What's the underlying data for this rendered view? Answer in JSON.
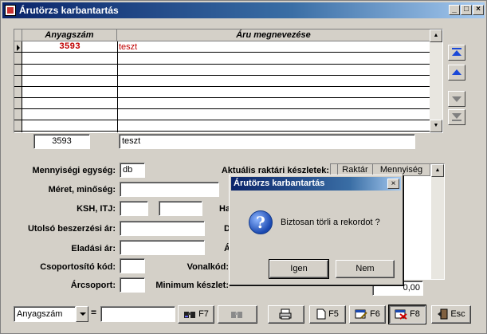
{
  "window": {
    "title": "Árutörzs karbantartás",
    "controls": {
      "min": "_",
      "max": "□",
      "close": "×"
    }
  },
  "grid": {
    "columns": [
      "Anyagszám",
      "Áru megnevezése"
    ],
    "rows": [
      {
        "code": "3593",
        "name": "teszt"
      }
    ]
  },
  "detail": {
    "code": "3593",
    "name": "teszt"
  },
  "form": {
    "unit_label": "Mennyiségi egység:",
    "unit_value": "db",
    "size_label": "Méret, minőség:",
    "ksh_label": "KSH, ITJ:",
    "last_price_label": "Utolsó beszerzési ár:",
    "sale_price_label": "Eladási ár:",
    "group_code_label": "Csoportosító kód:",
    "barcode_label": "Vonalkód:",
    "price_group_label": "Árcsoport:",
    "min_stock_label": "Minimum készlet:",
    "min_stock_value": "0,00",
    "partial_labels": {
      "ha": "Ha",
      "d": "D",
      "a": "Á"
    }
  },
  "stock_panel": {
    "title": "Aktuális raktári készletek:",
    "columns": [
      "Raktár",
      "Mennyiség"
    ]
  },
  "dialog": {
    "title": "Árutörzs karbantartás",
    "message": "Biztosan törli a rekordot ?",
    "icon_glyph": "?",
    "close": "×",
    "yes": "Igen",
    "no": "Nem"
  },
  "bottom": {
    "search_field": "Anyagszám",
    "eq": "=",
    "f7": "F7",
    "f5": "F5",
    "f6": "F6",
    "f8": "F8",
    "esc": "Esc"
  }
}
